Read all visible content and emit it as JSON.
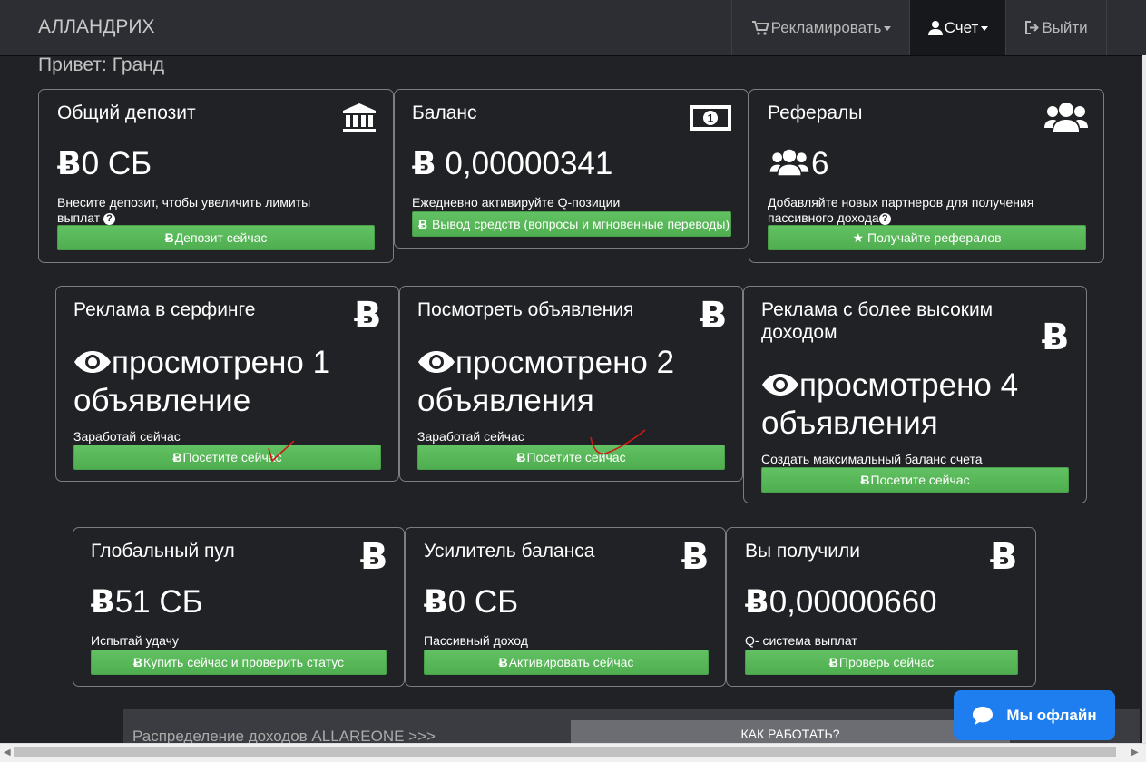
{
  "nav": {
    "brand": "АЛЛАНДРИХ",
    "advertise": "Рекламировать",
    "account": "Счет",
    "logout": "Выйти"
  },
  "greeting": "Привет: Гранд",
  "cards": {
    "deposit": {
      "title": "Общий депозит",
      "value": "0 СБ",
      "desc": "Внесите депозит, чтобы увеличить лимиты выплат",
      "button": "Депозит сейчас"
    },
    "balance": {
      "title": "Баланс",
      "value": "0,00000341",
      "desc": "Ежедневно активируйте Q-позиции",
      "button": "Вывод средств (вопросы и мгновенные переводы)"
    },
    "referrals": {
      "title": "Рефералы",
      "value": "6",
      "desc": "Добавляйте новых партнеров для получения пассивного дохода",
      "button": "Получайте рефералов"
    },
    "surf": {
      "title": "Реклама в серфинге",
      "value_line1": "просмотрено 1",
      "value_line2": "объявление",
      "desc": "Заработай сейчас",
      "button": "Посетите сейчас"
    },
    "view_ads": {
      "title": "Посмотреть объявления",
      "value_line1": "просмотрено 2",
      "value_line2": "объявления",
      "desc": "Заработай сейчас",
      "button": "Посетите сейчас"
    },
    "high_income": {
      "title_line1": "Реклама с более высоким",
      "title_line2": "доходом",
      "value_line1": "просмотрено 4",
      "value_line2": "объявления",
      "desc": "Создать максимальный баланс счета",
      "button": "Посетите сейчас"
    },
    "global_pool": {
      "title": "Глобальный пул",
      "value": "51 СБ",
      "desc": "Испытай удачу",
      "button": "Купить сейчас и проверить статус"
    },
    "booster": {
      "title": "Усилитель баланса",
      "value": "0 СБ",
      "desc": "Пассивный доход",
      "button": "Активировать сейчас"
    },
    "received": {
      "title": "Вы получили",
      "value": "0,00000660",
      "desc": "Q- система выплат",
      "button": "Проверь сейчас"
    }
  },
  "bottom": {
    "distribution_text": "Распределение доходов ALLAREONE >>>",
    "how_button": "КАК РАБОТАТЬ?"
  },
  "chat": {
    "label": "Мы офлайн"
  },
  "colors": {
    "accent_green": "#5cb85c",
    "chat_blue": "#1e7ef0",
    "background": "#202225"
  }
}
